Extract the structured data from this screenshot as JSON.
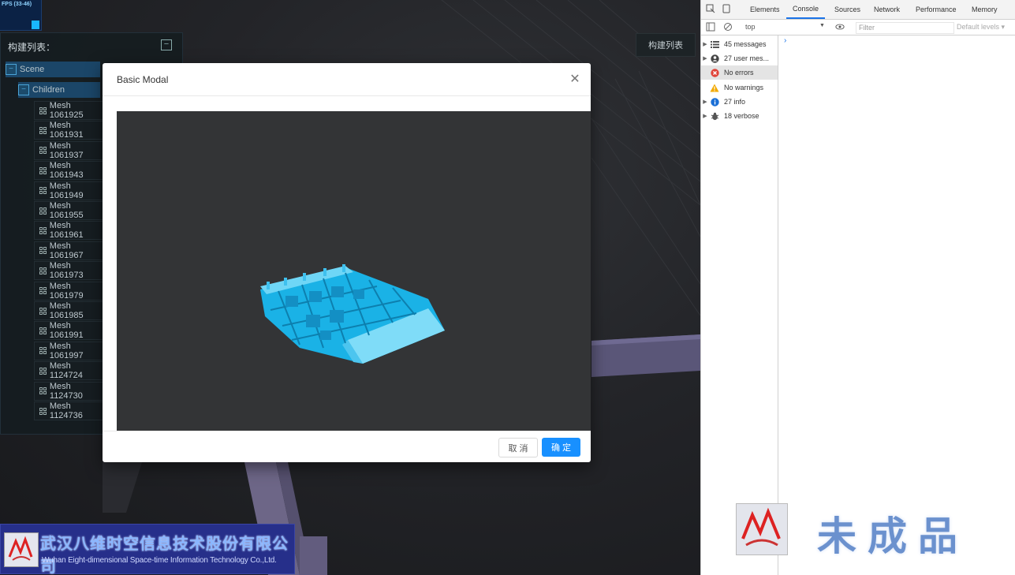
{
  "fps": {
    "label": "FPS (33-46)"
  },
  "tree": {
    "title": "构建列表：",
    "collapse_icon": "minus-square-icon",
    "scene_label": "Scene",
    "children_label": "Children",
    "items": [
      "Mesh 1061925",
      "Mesh 1061931",
      "Mesh 1061937",
      "Mesh 1061943",
      "Mesh 1061949",
      "Mesh 1061955",
      "Mesh 1061961",
      "Mesh 1061967",
      "Mesh 1061973",
      "Mesh 1061979",
      "Mesh 1061985",
      "Mesh 1061991",
      "Mesh 1061997",
      "Mesh 1124724",
      "Mesh 1124730",
      "Mesh 1124736"
    ]
  },
  "scene_button": {
    "label": "构建列表"
  },
  "modal": {
    "title": "Basic Modal",
    "close_glyph": "✕",
    "cancel_label": "取 消",
    "ok_label": "确 定",
    "model_color": "#1ab2e6"
  },
  "logo": {
    "cn": "武汉八维时空信息技术股份有限公司",
    "en": "Wuhan Eight-dimensional Space-time Information Technology Co.,Ltd."
  },
  "devtools": {
    "tabs": [
      "Elements",
      "Console",
      "Sources",
      "Network",
      "Performance",
      "Memory"
    ],
    "active_tab": "Console",
    "context": "top",
    "filter_placeholder": "Filter",
    "levels": "Default levels ▾",
    "sidebar": [
      {
        "label": "45 messages",
        "icon": "list-icon"
      },
      {
        "label": "27 user mes...",
        "icon": "user-icon"
      },
      {
        "label": "No errors",
        "icon": "error-icon"
      },
      {
        "label": "No warnings",
        "icon": "warning-icon"
      },
      {
        "label": "27 info",
        "icon": "info-icon"
      },
      {
        "label": "18 verbose",
        "icon": "bug-icon"
      }
    ],
    "prompt_glyph": "›"
  },
  "watermark": {
    "text": "未成品"
  }
}
